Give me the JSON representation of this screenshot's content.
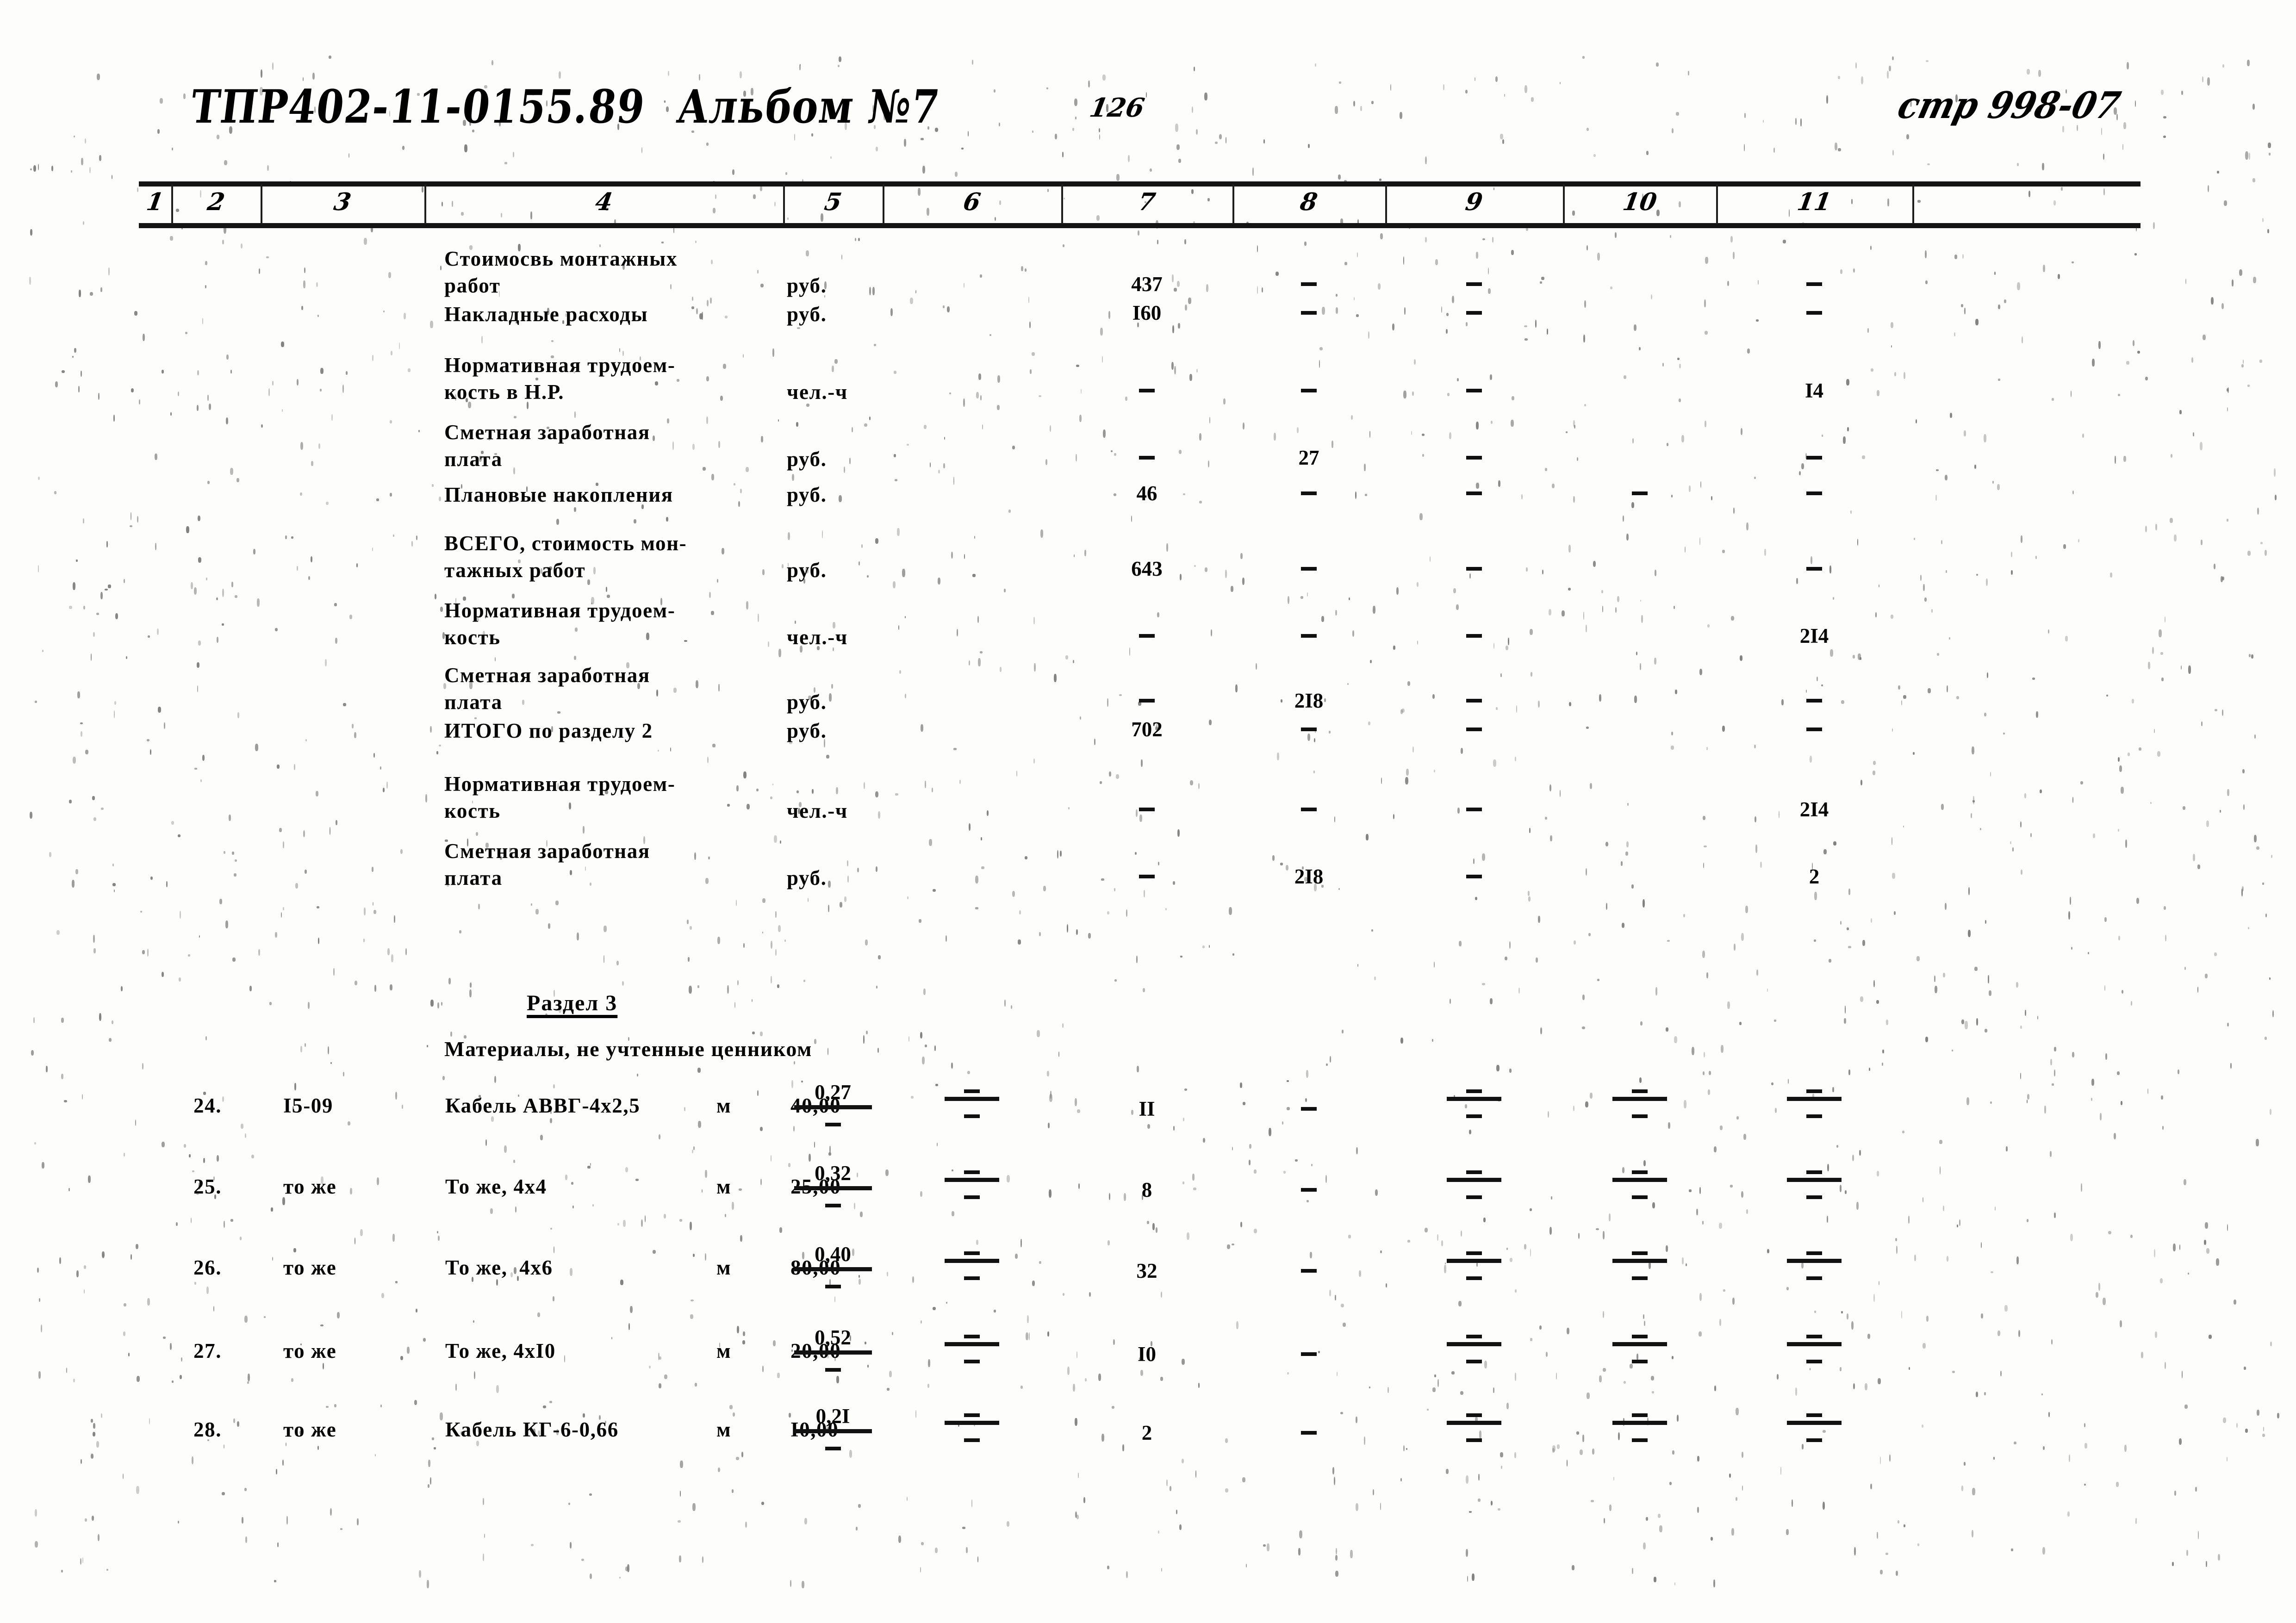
{
  "header": {
    "document_code": "ТПР402-11-0155.89",
    "album": "Альбом №7",
    "page_number": "126",
    "page_ref": "стр 998-07"
  },
  "table": {
    "column_numbers": [
      "1",
      "2",
      "3",
      "4",
      "5",
      "6",
      "7",
      "8",
      "9",
      "10",
      "11"
    ],
    "summary_rows": [
      {
        "name": "Стоимосвь монтажных\nработ",
        "unit": "руб.",
        "c5": "",
        "c6": "",
        "c7": "437",
        "c8": "–",
        "c9": "–",
        "c10": "",
        "c11": "–"
      },
      {
        "name": "Накладные расходы",
        "unit": "руб.",
        "c5": "",
        "c6": "",
        "c7": "I60",
        "c8": "–",
        "c9": "–",
        "c10": "",
        "c11": "–"
      },
      {
        "name": "Нормативная трудоем-\nкость в Н.Р.",
        "unit": "чел.-ч",
        "c5": "",
        "c6": "",
        "c7": "–",
        "c8": "–",
        "c9": "–",
        "c10": "",
        "c11": "I4"
      },
      {
        "name": "Сметная заработная\nплата",
        "unit": "руб.",
        "c5": "",
        "c6": "",
        "c7": "–",
        "c8": "27",
        "c9": "–",
        "c10": "",
        "c11": "–"
      },
      {
        "name": "Плановые накопления",
        "unit": "руб.",
        "c5": "",
        "c6": "",
        "c7": "46",
        "c8": "–",
        "c9": "–",
        "c10": "–",
        "c11": "–"
      },
      {
        "name": "ВСЕГО, стоимость мон-\nтажных работ",
        "unit": "руб.",
        "c5": "",
        "c6": "",
        "c7": "643",
        "c8": "–",
        "c9": "–",
        "c10": "",
        "c11": "–"
      },
      {
        "name": "Нормативная трудоем-\nкость",
        "unit": "чел.-ч",
        "c5": "",
        "c6": "",
        "c7": "–",
        "c8": "–",
        "c9": "–",
        "c10": "",
        "c11": "2I4"
      },
      {
        "name": "Сметная заработная\nплата",
        "unit": "руб.",
        "c5": "",
        "c6": "",
        "c7": "–",
        "c8": "2I8",
        "c9": "–",
        "c10": "",
        "c11": "–"
      },
      {
        "name": "ИТОГО по разделу 2",
        "unit": "руб.",
        "c5": "",
        "c6": "",
        "c7": "702",
        "c8": "–",
        "c9": "–",
        "c10": "",
        "c11": "–"
      },
      {
        "name": "Нормативная трудоем-\nкость",
        "unit": "чел.-ч",
        "c5": "",
        "c6": "",
        "c7": "–",
        "c8": "–",
        "c9": "–",
        "c10": "",
        "c11": "2I4"
      },
      {
        "name": "Сметная заработная\nплата",
        "unit": "руб.",
        "c5": "",
        "c6": "",
        "c7": "–",
        "c8": "2I8",
        "c9": "–",
        "c10": "",
        "c11": "2"
      }
    ],
    "section": {
      "title": "Раздел 3",
      "subtitle": "Материалы, не учтенные ценником"
    },
    "material_rows": [
      {
        "no": "24.",
        "code": "I5-09",
        "name": "Кабель АВВГ-4х2,5",
        "unit": "м",
        "qty": "40,00",
        "c5_top": "0,27",
        "c5_bot": "–",
        "c6_top": "–",
        "c6_bot": "–",
        "c7": "II",
        "c8": "–",
        "c9_top": "–",
        "c9_bot": "–",
        "c10_top": "–",
        "c10_bot": "–",
        "c11_top": "–",
        "c11_bot": "–"
      },
      {
        "no": "25.",
        "code": "то же",
        "name": "То же, 4х4",
        "unit": "м",
        "qty": "25,00",
        "c5_top": "0,32",
        "c5_bot": "–",
        "c6_top": "–",
        "c6_bot": "–",
        "c7": "8",
        "c8": "–",
        "c9_top": "–",
        "c9_bot": "–",
        "c10_top": "–",
        "c10_bot": "–",
        "c11_top": "–",
        "c11_bot": "–"
      },
      {
        "no": "26.",
        "code": "то же",
        "name": "То же,  4х6",
        "unit": "м",
        "qty": "80,00",
        "c5_top": "0,40",
        "c5_bot": "–",
        "c6_top": "–",
        "c6_bot": "–",
        "c7": "32",
        "c8": "–",
        "c9_top": "–",
        "c9_bot": "–",
        "c10_top": "–",
        "c10_bot": "–",
        "c11_top": "–",
        "c11_bot": "–"
      },
      {
        "no": "27.",
        "code": "то же",
        "name": "То же, 4хI0",
        "unit": "м",
        "qty": "20,00",
        "c5_top": "0,52",
        "c5_bot": "–",
        "c6_top": "–",
        "c6_bot": "–",
        "c7": "I0",
        "c8": "–",
        "c9_top": "–",
        "c9_bot": "–",
        "c10_top": "–",
        "c10_bot": "–",
        "c11_top": "–",
        "c11_bot": "–"
      },
      {
        "no": "28.",
        "code": "то же",
        "name": "Кабель КГ-6-0,66",
        "unit": "м",
        "qty": "I0,00",
        "c5_top": "0,2I",
        "c5_bot": "–",
        "c6_top": "–",
        "c6_bot": "–",
        "c7": "2",
        "c8": "–",
        "c9_top": "–",
        "c9_bot": "–",
        "c10_top": "–",
        "c10_bot": "–",
        "c11_top": "–",
        "c11_bot": "–"
      }
    ]
  }
}
